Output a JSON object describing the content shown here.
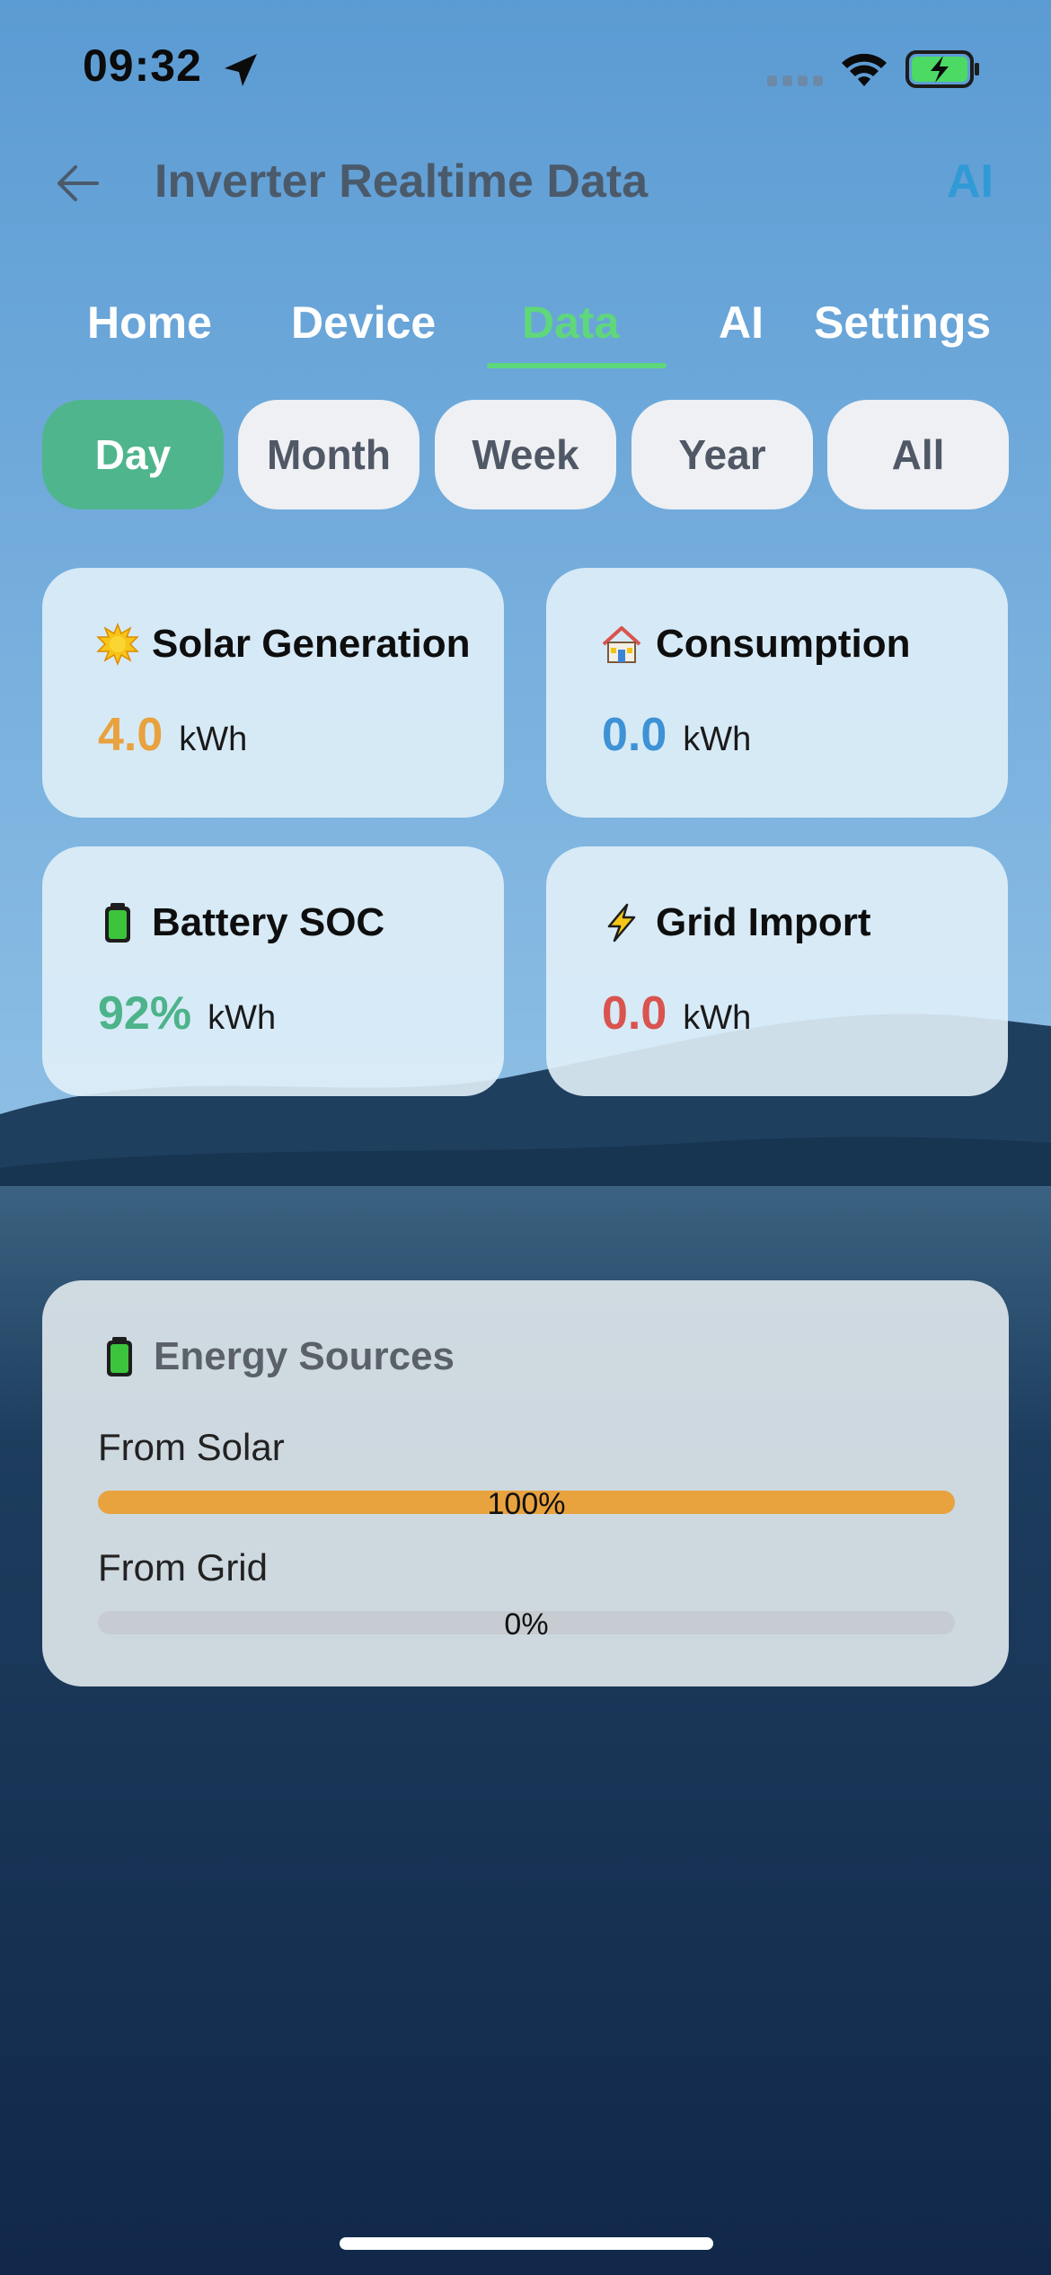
{
  "status_bar": {
    "time": "09:32",
    "icons": [
      "location-arrow-icon",
      "signal-icon",
      "wifi-icon",
      "battery-charging-icon"
    ]
  },
  "header": {
    "title": "Inverter Realtime Data",
    "ai_link": "AI",
    "back_icon": "arrow-left-icon"
  },
  "tabs": [
    {
      "label": "Home",
      "active": false
    },
    {
      "label": "Device",
      "active": false
    },
    {
      "label": "Data",
      "active": true
    },
    {
      "label": "AI",
      "active": false
    },
    {
      "label": "Settings",
      "active": false
    }
  ],
  "periods": [
    {
      "label": "Day",
      "active": true
    },
    {
      "label": "Month",
      "active": false
    },
    {
      "label": "Week",
      "active": false
    },
    {
      "label": "Year",
      "active": false
    },
    {
      "label": "All",
      "active": false
    }
  ],
  "stats": [
    {
      "title": "Solar Generation",
      "icon": "sun-icon",
      "value": "4.0",
      "unit": "kWh",
      "color": "#e8a23e"
    },
    {
      "title": "Consumption",
      "icon": "house-icon",
      "value": "0.0",
      "unit": "kWh",
      "color": "#3e92d6"
    },
    {
      "title": "Battery SOC",
      "icon": "battery-icon",
      "value": "92%",
      "unit": "kWh",
      "color": "#4db38a"
    },
    {
      "title": "Grid Import",
      "icon": "lightning-icon",
      "value": "0.0",
      "unit": "kWh",
      "color": "#d9534f"
    }
  ],
  "energy_sources": {
    "title": "Energy Sources",
    "icon": "battery-icon",
    "items": [
      {
        "label": "From Solar",
        "percent_text": "100%",
        "fraction": 1.0,
        "color": "#e8a23e"
      },
      {
        "label": "From Grid",
        "percent_text": "0%",
        "fraction": 0.0,
        "color": "#e8a23e"
      }
    ]
  },
  "colors": {
    "accent_green": "#5fd77b",
    "active_period": "#4fb58d",
    "ai_blue": "#2f9ad6"
  }
}
